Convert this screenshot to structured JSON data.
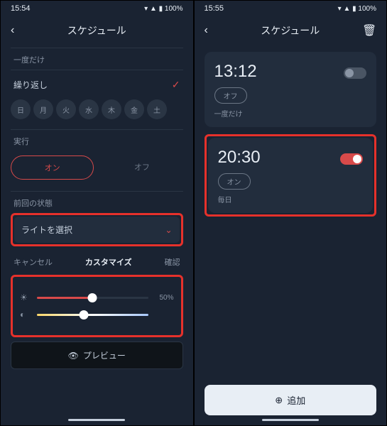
{
  "left": {
    "status": {
      "time": "15:54",
      "icons": "▲ ⬤",
      "right": "▾ ▲ ▮ 100%"
    },
    "header": {
      "title": "スケジュール"
    },
    "once_label": "一度だけ",
    "repeat_label": "繰り返し",
    "days": [
      "日",
      "月",
      "火",
      "水",
      "木",
      "金",
      "土"
    ],
    "exec_label": "実行",
    "exec_on": "オン",
    "exec_off": "オフ",
    "prev_state_label": "前回の状態",
    "select_light": "ライトを選択",
    "cancel": "キャンセル",
    "customize": "カスタマイズ",
    "confirm": "確認",
    "brightness_val": "50%",
    "preview": "プレビュー"
  },
  "right": {
    "status": {
      "time": "15:55",
      "icons": "▲ ⬤",
      "right": "▾ ▲ ▮ 100%"
    },
    "header": {
      "title": "スケジュール"
    },
    "cards": [
      {
        "time": "13:12",
        "pill": "オフ",
        "sub": "一度だけ",
        "on": false
      },
      {
        "time": "20:30",
        "pill": "オン",
        "sub": "毎日",
        "on": true
      }
    ],
    "add": "追加"
  }
}
